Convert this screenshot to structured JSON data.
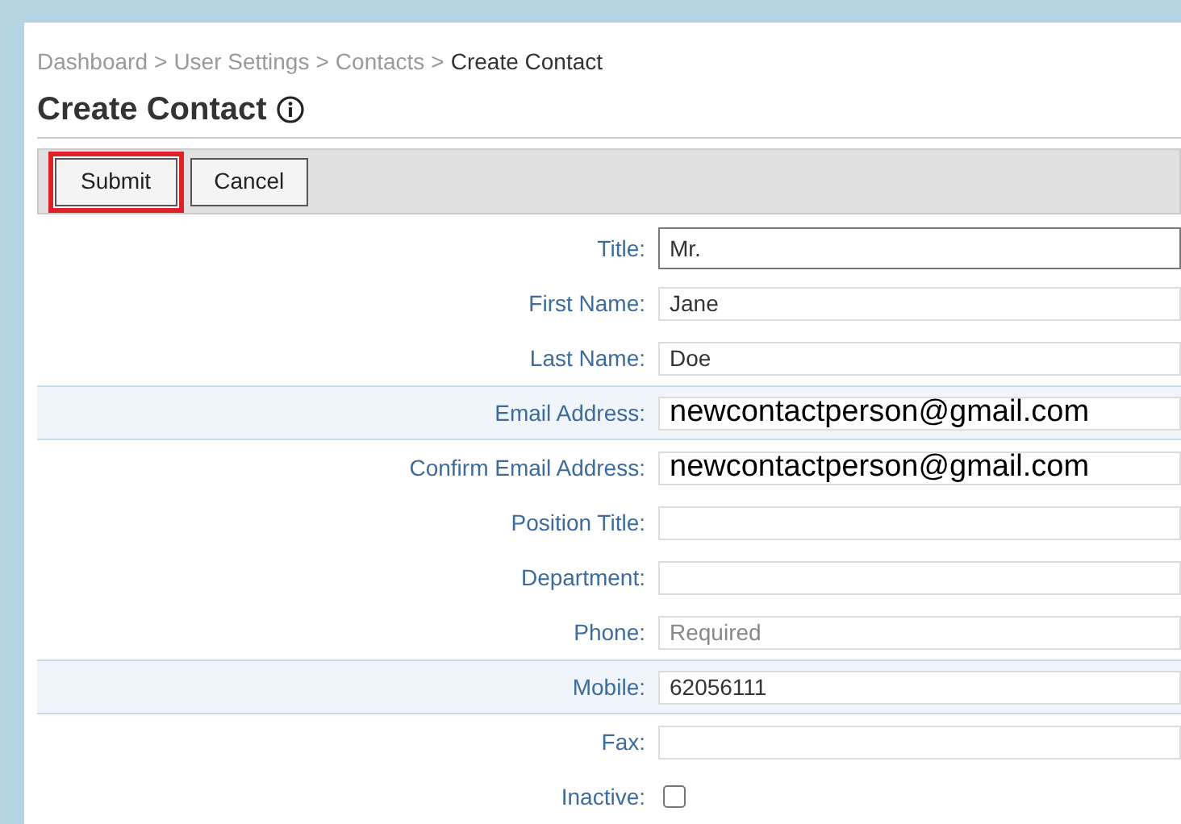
{
  "breadcrumb": [
    {
      "label": "Dashboard",
      "current": false
    },
    {
      "label": "User Settings",
      "current": false
    },
    {
      "label": "Contacts",
      "current": false
    },
    {
      "label": "Create Contact",
      "current": true
    }
  ],
  "separator": ">",
  "page_title": "Create Contact",
  "toolbar": [
    {
      "label": "Submit",
      "highlighted": true
    },
    {
      "label": "Cancel",
      "highlighted": false
    }
  ],
  "fields": [
    {
      "kind": "text",
      "label": "Title:",
      "value": "Mr.",
      "focused": true,
      "highlighted": false,
      "enlarged": false
    },
    {
      "kind": "text",
      "label": "First Name:",
      "value": "Jane",
      "focused": false,
      "highlighted": false,
      "enlarged": false
    },
    {
      "kind": "text",
      "label": "Last Name:",
      "value": "Doe",
      "focused": false,
      "highlighted": false,
      "enlarged": false
    },
    {
      "kind": "text",
      "label": "Email Address:",
      "value": "newcontactperson@gmail.com",
      "focused": false,
      "highlighted": true,
      "enlarged": true
    },
    {
      "kind": "text",
      "label": "Confirm Email Address:",
      "value": "newcontactperson@gmail.com",
      "focused": false,
      "highlighted": false,
      "enlarged": true
    },
    {
      "kind": "text",
      "label": "Position Title:",
      "focused": false,
      "highlighted": false
    },
    {
      "kind": "text",
      "label": "Department:",
      "focused": false,
      "highlighted": false
    },
    {
      "kind": "text",
      "label": "Phone:",
      "placeholder": "Required",
      "focused": false,
      "highlighted": false,
      "enlarged": false
    },
    {
      "kind": "text",
      "label": "Mobile:",
      "value": "62056111",
      "focused": false,
      "highlighted": true,
      "enlarged": false
    },
    {
      "kind": "text",
      "label": "Fax:",
      "focused": false,
      "highlighted": false
    },
    {
      "kind": "checkbox",
      "label": "Inactive:",
      "checked": false,
      "highlighted": false
    }
  ]
}
